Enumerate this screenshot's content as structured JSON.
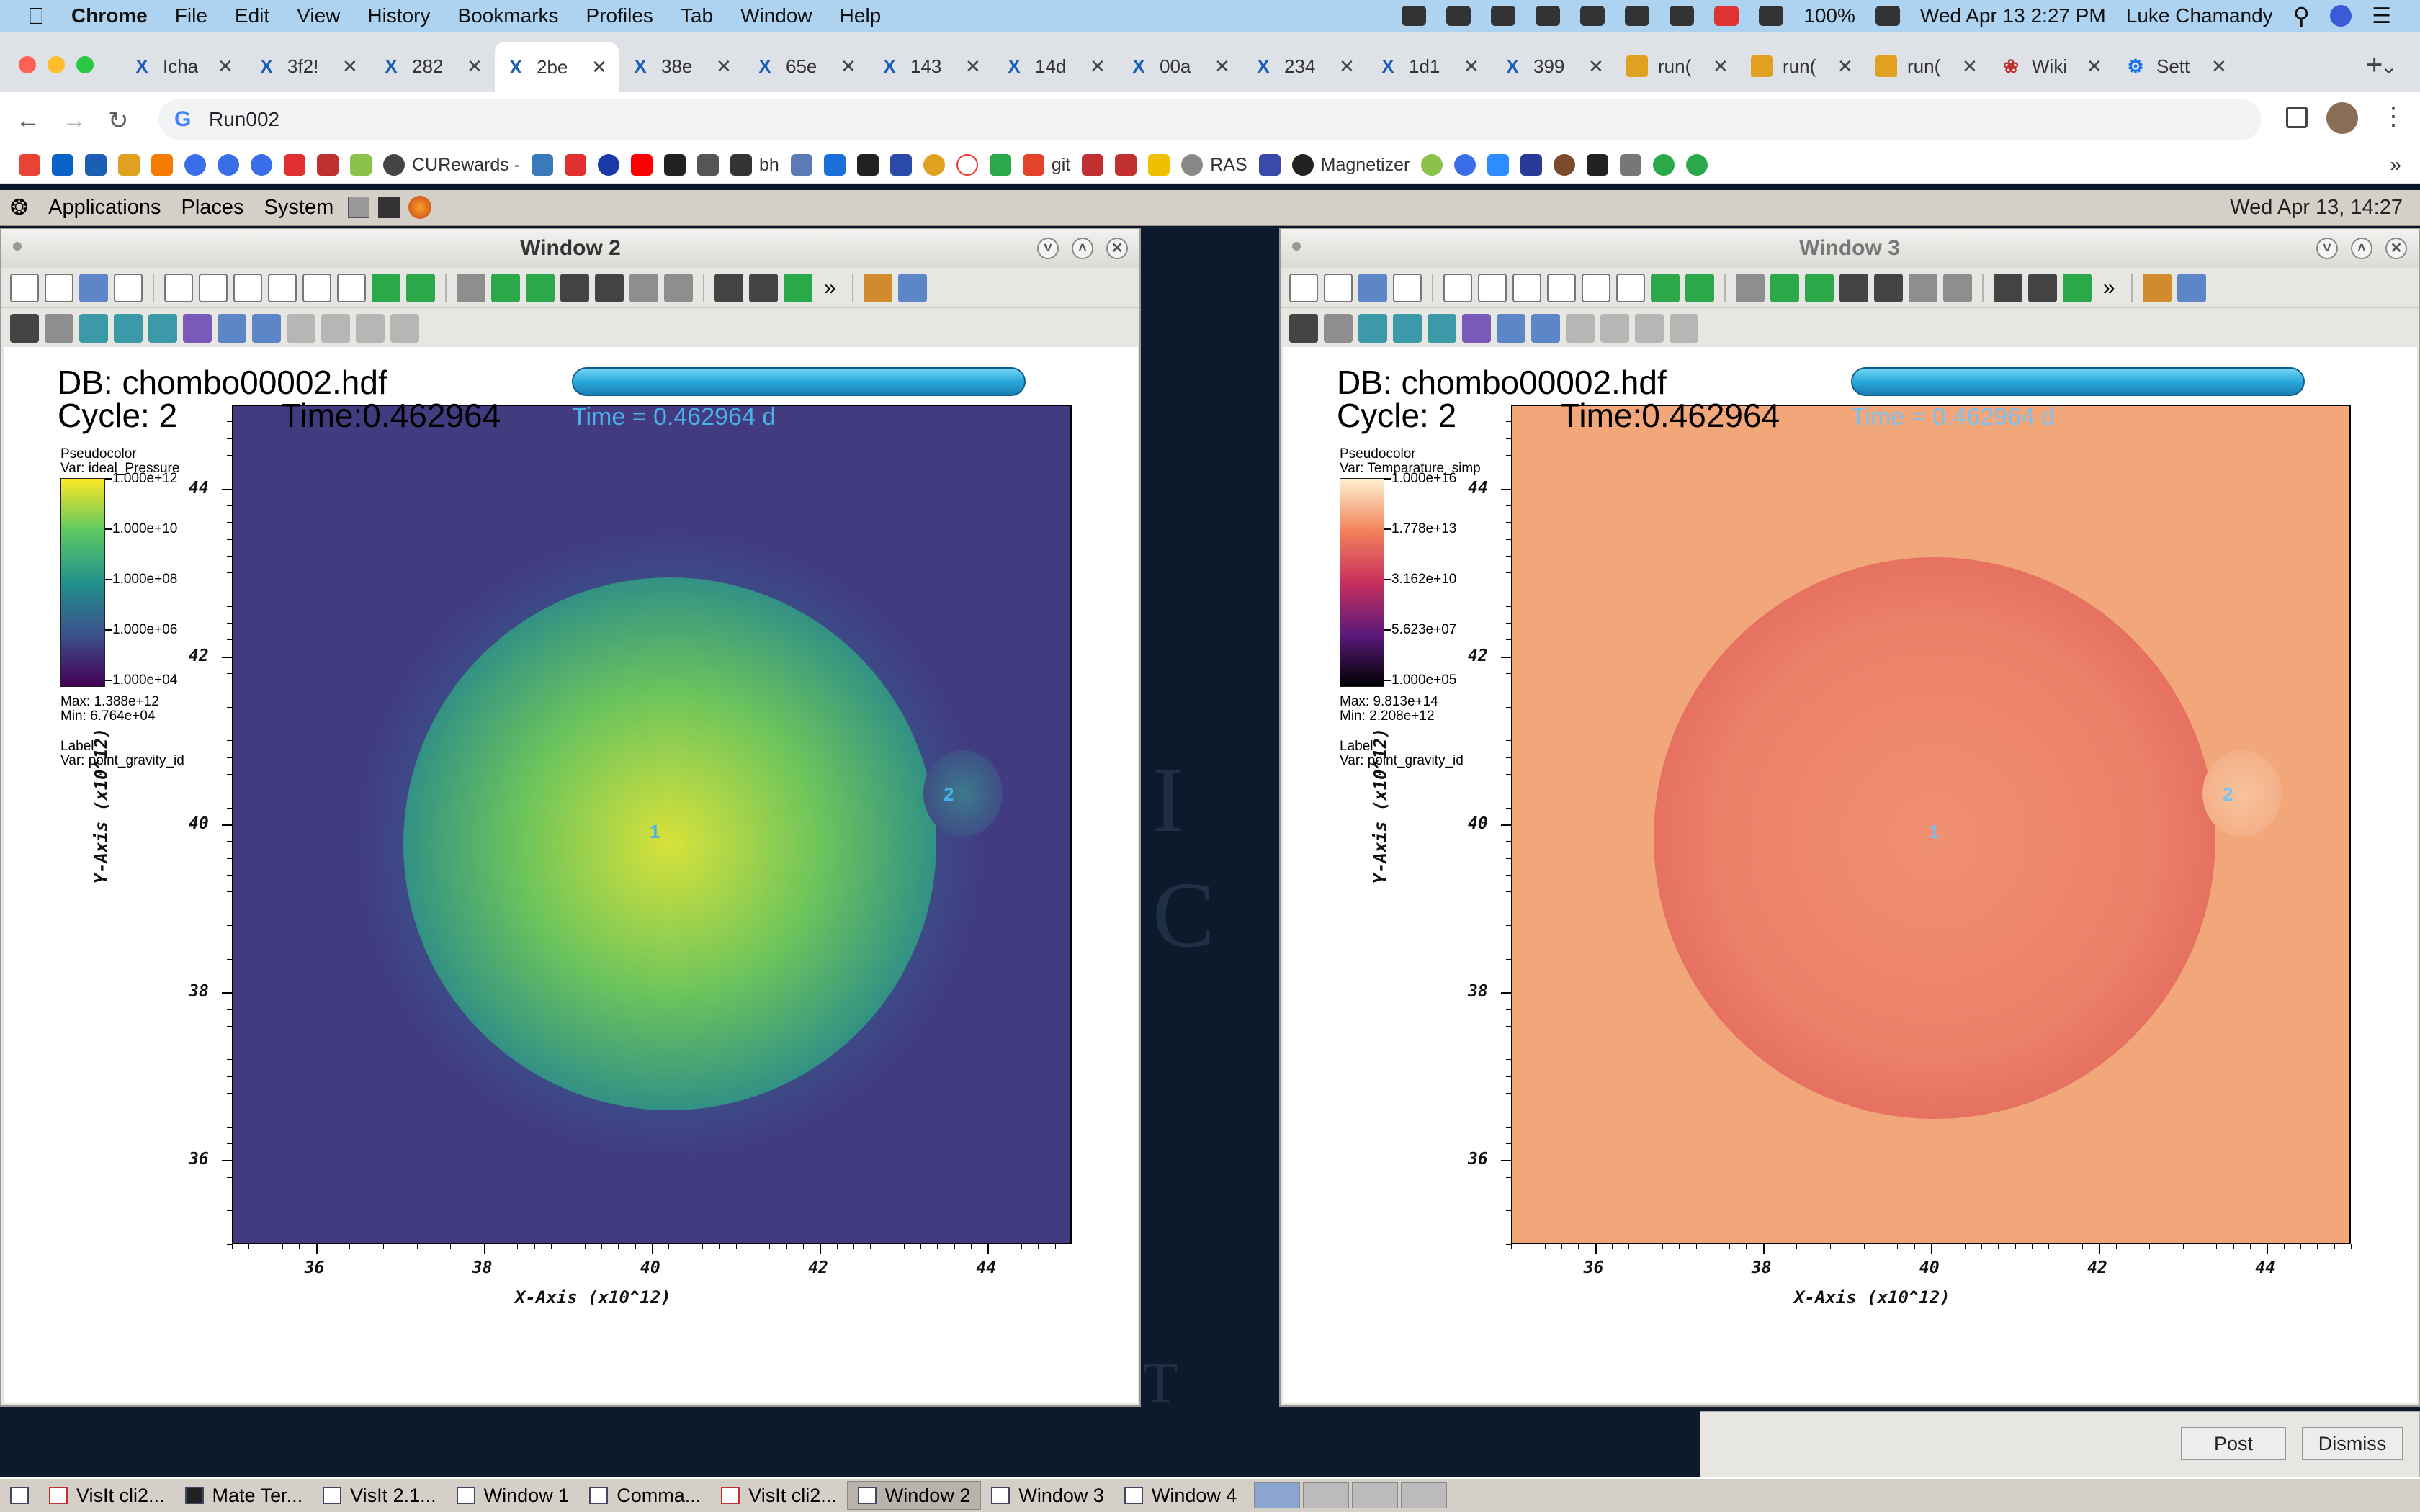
{
  "menubar": {
    "app": "Chrome",
    "items": [
      "File",
      "Edit",
      "View",
      "History",
      "Bookmarks",
      "Profiles",
      "Tab",
      "Window",
      "Help"
    ],
    "battery": "100%",
    "datetime": "Wed Apr 13  2:27 PM",
    "user": "Luke Chamandy"
  },
  "tabs": [
    {
      "label": "Icha",
      "icon": "arxiv-icon"
    },
    {
      "label": "3f2!",
      "icon": "arxiv-icon"
    },
    {
      "label": "282",
      "icon": "arxiv-icon"
    },
    {
      "label": "2be",
      "icon": "arxiv-icon",
      "active": true
    },
    {
      "label": "38e",
      "icon": "arxiv-icon"
    },
    {
      "label": "65e",
      "icon": "arxiv-icon"
    },
    {
      "label": "143",
      "icon": "arxiv-icon"
    },
    {
      "label": "14d",
      "icon": "arxiv-icon"
    },
    {
      "label": "00a",
      "icon": "arxiv-icon"
    },
    {
      "label": "234",
      "icon": "arxiv-icon"
    },
    {
      "label": "1d1",
      "icon": "arxiv-icon"
    },
    {
      "label": "399",
      "icon": "arxiv-icon"
    },
    {
      "label": "run(",
      "icon": "visit-icon"
    },
    {
      "label": "run(",
      "icon": "visit-icon"
    },
    {
      "label": "run(",
      "icon": "visit-icon"
    },
    {
      "label": "Wiki",
      "icon": "paw-icon"
    },
    {
      "label": "Sett",
      "icon": "gear-icon"
    }
  ],
  "address": {
    "value": "Run002"
  },
  "bookmarks": {
    "curewards": "CURewards -",
    "bh": "bh",
    "git": "git",
    "ras": "RAS",
    "magnetizer": "Magnetizer"
  },
  "gnome": {
    "applications": "Applications",
    "places": "Places",
    "system": "System",
    "clock": "Wed Apr 13, 14:27"
  },
  "windows": [
    {
      "title": "Window 2",
      "db": "DB: chombo00002.hdf",
      "cycle": "Cycle: 2",
      "time": "Time:0.462964",
      "time_annot": "Time = 0.462964 d",
      "plot_type": "Pseudocolor",
      "var": "Var: ideal_Pressure",
      "legend_labels": [
        "1.000e+12",
        "1.000e+10",
        "1.000e+08",
        "1.000e+06",
        "1.000e+04"
      ],
      "max": "Max:  1.388e+12",
      "min": "Min:  6.764e+04",
      "label_title": "Label",
      "label_var": "Var: point_gravity_id",
      "colormap": [
        "#fde725",
        "#5ec962",
        "#21918c",
        "#3b528b",
        "#440154"
      ],
      "bg": "#423b80",
      "circle_center": "#d8e23a",
      "circle_mid": "#6cc45c",
      "circle_edge": "#2a8a8a",
      "annot_color": "#4ab0e8"
    },
    {
      "title": "Window 3",
      "db": "DB: chombo00002.hdf",
      "cycle": "Cycle: 2",
      "time": "Time:0.462964",
      "time_annot": "Time = 0.462964 d",
      "plot_type": "Pseudocolor",
      "var": "Var: Temparature_simp",
      "legend_labels": [
        "1.000e+16",
        "1.778e+13",
        "3.162e+10",
        "5.623e+07",
        "1.000e+05"
      ],
      "max": "Max:  9.813e+14",
      "min": "Min:  2.208e+12",
      "label_title": "Label",
      "label_var": "Var: point_gravity_id",
      "colormap": [
        "#fdf0d0",
        "#f3825a",
        "#c8305e",
        "#5c1a7a",
        "#000004"
      ],
      "bg": "#f2a77a",
      "circle_center": "#f09070",
      "circle_mid": "#ec8068",
      "circle_edge": "#dc5c58",
      "annot_color": "#7ac0f0"
    }
  ],
  "axes": {
    "x_ticks": [
      "36",
      "38",
      "40",
      "42",
      "44"
    ],
    "y_ticks": [
      "44",
      "42",
      "40",
      "38",
      "36"
    ],
    "x_label": "X-Axis (x10^12)",
    "y_label": "Y-Axis (x10^12)",
    "marker1": "1",
    "marker2": "2"
  },
  "dialog": {
    "post": "Post",
    "dismiss": "Dismiss"
  },
  "taskbar": [
    {
      "label": "VisIt cli2...",
      "icon": "visit-icon"
    },
    {
      "label": "Mate Ter...",
      "icon": "terminal-icon"
    },
    {
      "label": "VisIt 2.1...",
      "icon": "window-icon"
    },
    {
      "label": "Window 1",
      "icon": "window-icon"
    },
    {
      "label": "Comma...",
      "icon": "window-icon"
    },
    {
      "label": "VisIt cli2...",
      "icon": "visit-icon"
    },
    {
      "label": "Window 2",
      "icon": "window-icon",
      "active": true
    },
    {
      "label": "Window 3",
      "icon": "window-icon"
    },
    {
      "label": "Window 4",
      "icon": "window-icon"
    }
  ]
}
